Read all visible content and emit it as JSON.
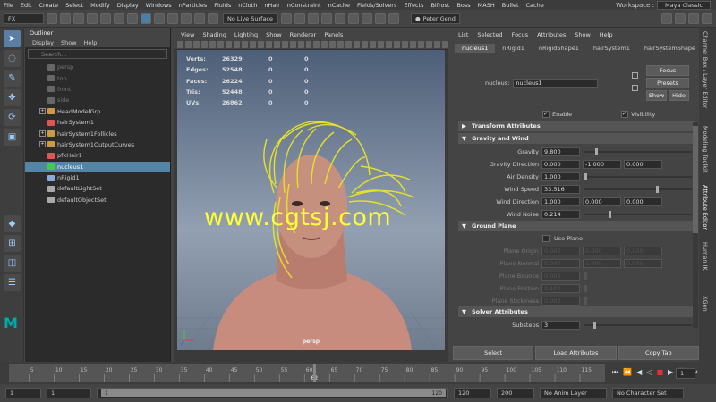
{
  "menubar": {
    "items": [
      "File",
      "Edit",
      "Create",
      "Select",
      "Modify",
      "Display",
      "Windows",
      "nParticles",
      "Fluids",
      "nCloth",
      "nHair",
      "nConstraint",
      "nCache",
      "Fields/Solvers",
      "Effects",
      "Bifrost",
      "Boss",
      "MASH",
      "Bullet",
      "Cache"
    ],
    "workspace_label": "Workspace :",
    "workspace_value": "Maya Classic"
  },
  "toolbar": {
    "mode": "FX",
    "live_surface": "No Live Surface",
    "user": "Peter Gend"
  },
  "outliner": {
    "title": "Outliner",
    "menu": [
      "Display",
      "Show",
      "Help"
    ],
    "search_placeholder": "Search...",
    "items": [
      {
        "label": "persp",
        "dim": true,
        "expand": false,
        "icon": "#666"
      },
      {
        "label": "top",
        "dim": true,
        "expand": false,
        "icon": "#666"
      },
      {
        "label": "front",
        "dim": true,
        "expand": false,
        "icon": "#666"
      },
      {
        "label": "side",
        "dim": true,
        "expand": false,
        "icon": "#666"
      },
      {
        "label": "HeadModelGrp",
        "dim": false,
        "expand": true,
        "icon": "#c94"
      },
      {
        "label": "hairSystem1",
        "dim": false,
        "expand": false,
        "icon": "#d55"
      },
      {
        "label": "hairSystem1Follicles",
        "dim": false,
        "expand": true,
        "icon": "#c94"
      },
      {
        "label": "hairSystem1OutputCurves",
        "dim": false,
        "expand": true,
        "icon": "#c94"
      },
      {
        "label": "pfxHair1",
        "dim": false,
        "expand": false,
        "icon": "#d55"
      },
      {
        "label": "nucleus1",
        "dim": false,
        "expand": false,
        "icon": "#4c4",
        "selected": true
      },
      {
        "label": "nRigid1",
        "dim": false,
        "expand": false,
        "icon": "#8ad"
      },
      {
        "label": "defaultLightSet",
        "dim": false,
        "expand": false,
        "icon": "#aaa"
      },
      {
        "label": "defaultObjectSet",
        "dim": false,
        "expand": false,
        "icon": "#aaa"
      }
    ]
  },
  "viewport": {
    "menu": [
      "View",
      "Shading",
      "Lighting",
      "Show",
      "Renderer",
      "Panels"
    ],
    "hud": [
      {
        "k": "Verts:",
        "v1": "26329",
        "v2": "0",
        "v3": "0"
      },
      {
        "k": "Edges:",
        "v1": "52548",
        "v2": "0",
        "v3": "0"
      },
      {
        "k": "Faces:",
        "v1": "26224",
        "v2": "0",
        "v3": "0"
      },
      {
        "k": "Tris:",
        "v1": "52448",
        "v2": "0",
        "v3": "0"
      },
      {
        "k": "UVs:",
        "v1": "26862",
        "v2": "0",
        "v3": "0"
      }
    ],
    "camera": "persp",
    "watermark": "www.cgtsj.com"
  },
  "attr": {
    "menu": [
      "List",
      "Selected",
      "Focus",
      "Attributes",
      "Show",
      "Help"
    ],
    "tabs": [
      "nucleus1",
      "nRigid1",
      "nRigidShape1",
      "hairSystem1",
      "hairSystemShape"
    ],
    "node_label": "nucleus:",
    "node_value": "nucleus1",
    "focus": "Focus",
    "presets": "Presets",
    "show": "Show",
    "hide": "Hide",
    "enable": "Enable",
    "visibility": "Visibility",
    "sections": {
      "transform": "Transform Attributes",
      "gravity": "Gravity and Wind",
      "ground": "Ground Plane",
      "solver": "Solver Attributes"
    },
    "gravity_rows": [
      {
        "label": "Gravity",
        "vals": [
          "9.800"
        ],
        "slider": 0.1
      },
      {
        "label": "Gravity Direction",
        "vals": [
          "0.000",
          "-1.000",
          "0.000"
        ]
      },
      {
        "label": "Air Density",
        "vals": [
          "1.000"
        ],
        "slider": 0.0
      },
      {
        "label": "Wind Speed",
        "vals": [
          "33.516"
        ],
        "slider": 0.68
      },
      {
        "label": "Wind Direction",
        "vals": [
          "1.000",
          "0.000",
          "0.000"
        ]
      },
      {
        "label": "Wind Noise",
        "vals": [
          "0.214"
        ],
        "slider": 0.23
      }
    ],
    "use_plane": "Use Plane",
    "plane_rows": [
      {
        "label": "Plane Origin",
        "vals": [
          "0.000",
          "0.000",
          "0.000"
        ]
      },
      {
        "label": "Plane Normal",
        "vals": [
          "0.000",
          "1.000",
          "0.000"
        ]
      },
      {
        "label": "Plane Bounce",
        "vals": [
          "0.000"
        ]
      },
      {
        "label": "Plane Friction",
        "vals": [
          "0.100"
        ]
      },
      {
        "label": "Plane Stickiness",
        "vals": [
          "0.000"
        ]
      }
    ],
    "substeps_label": "Substeps",
    "substeps_value": "3",
    "buttons": [
      "Select",
      "Load Attributes",
      "Copy Tab"
    ]
  },
  "vtabs": [
    "Channel Box / Layer Editor",
    "Modeling Toolkit",
    "Attribute Editor",
    "Human IK",
    "XGen"
  ],
  "timeline": {
    "ticks": [
      "5",
      "10",
      "15",
      "20",
      "25",
      "30",
      "35",
      "40",
      "45",
      "50",
      "55",
      "60",
      "65",
      "70",
      "75",
      "80",
      "85",
      "90",
      "95",
      "100",
      "105",
      "110",
      "115"
    ],
    "current": "62",
    "frame": "1"
  },
  "range": {
    "start": "1",
    "start2": "1",
    "slider_start": "1",
    "slider_end": "120",
    "end": "120",
    "end2": "200",
    "anim_layer": "No Anim Layer",
    "char_set": "No Character Set"
  }
}
